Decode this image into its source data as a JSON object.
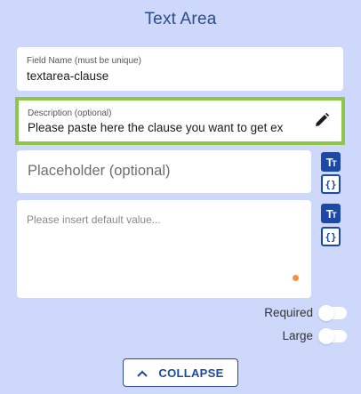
{
  "title": "Text Area",
  "field_name": {
    "label": "Field Name (must be unique)",
    "value": "textarea-clause"
  },
  "description": {
    "label": "Description (optional)",
    "value": "Please paste here the clause you want to get ex",
    "highlight_color": "#8dc64a"
  },
  "placeholder_field": {
    "placeholder": "Placeholder (optional)"
  },
  "default_value_field": {
    "placeholder": "Please insert default value..."
  },
  "toggles": {
    "required_label": "Required",
    "large_label": "Large"
  },
  "collapse": {
    "label": "COLLAPSE"
  },
  "icons": {
    "text_format": "text-format-icon",
    "variable": "variable-braces-icon",
    "edit": "pencil-icon",
    "collapse": "chevron-up-icon"
  },
  "colors": {
    "background": "#cdd8fb",
    "accent": "#1c49a6",
    "title": "#2d4b8e",
    "status_dot": "#f5913e"
  }
}
